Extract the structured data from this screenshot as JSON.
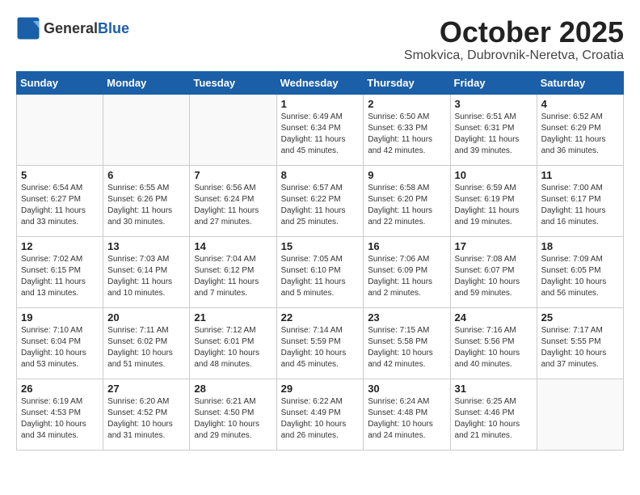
{
  "header": {
    "logo_general": "General",
    "logo_blue": "Blue",
    "month": "October 2025",
    "location": "Smokvica, Dubrovnik-Neretva, Croatia"
  },
  "weekdays": [
    "Sunday",
    "Monday",
    "Tuesday",
    "Wednesday",
    "Thursday",
    "Friday",
    "Saturday"
  ],
  "weeks": [
    [
      {
        "day": "",
        "info": ""
      },
      {
        "day": "",
        "info": ""
      },
      {
        "day": "",
        "info": ""
      },
      {
        "day": "1",
        "info": "Sunrise: 6:49 AM\nSunset: 6:34 PM\nDaylight: 11 hours\nand 45 minutes."
      },
      {
        "day": "2",
        "info": "Sunrise: 6:50 AM\nSunset: 6:33 PM\nDaylight: 11 hours\nand 42 minutes."
      },
      {
        "day": "3",
        "info": "Sunrise: 6:51 AM\nSunset: 6:31 PM\nDaylight: 11 hours\nand 39 minutes."
      },
      {
        "day": "4",
        "info": "Sunrise: 6:52 AM\nSunset: 6:29 PM\nDaylight: 11 hours\nand 36 minutes."
      }
    ],
    [
      {
        "day": "5",
        "info": "Sunrise: 6:54 AM\nSunset: 6:27 PM\nDaylight: 11 hours\nand 33 minutes."
      },
      {
        "day": "6",
        "info": "Sunrise: 6:55 AM\nSunset: 6:26 PM\nDaylight: 11 hours\nand 30 minutes."
      },
      {
        "day": "7",
        "info": "Sunrise: 6:56 AM\nSunset: 6:24 PM\nDaylight: 11 hours\nand 27 minutes."
      },
      {
        "day": "8",
        "info": "Sunrise: 6:57 AM\nSunset: 6:22 PM\nDaylight: 11 hours\nand 25 minutes."
      },
      {
        "day": "9",
        "info": "Sunrise: 6:58 AM\nSunset: 6:20 PM\nDaylight: 11 hours\nand 22 minutes."
      },
      {
        "day": "10",
        "info": "Sunrise: 6:59 AM\nSunset: 6:19 PM\nDaylight: 11 hours\nand 19 minutes."
      },
      {
        "day": "11",
        "info": "Sunrise: 7:00 AM\nSunset: 6:17 PM\nDaylight: 11 hours\nand 16 minutes."
      }
    ],
    [
      {
        "day": "12",
        "info": "Sunrise: 7:02 AM\nSunset: 6:15 PM\nDaylight: 11 hours\nand 13 minutes."
      },
      {
        "day": "13",
        "info": "Sunrise: 7:03 AM\nSunset: 6:14 PM\nDaylight: 11 hours\nand 10 minutes."
      },
      {
        "day": "14",
        "info": "Sunrise: 7:04 AM\nSunset: 6:12 PM\nDaylight: 11 hours\nand 7 minutes."
      },
      {
        "day": "15",
        "info": "Sunrise: 7:05 AM\nSunset: 6:10 PM\nDaylight: 11 hours\nand 5 minutes."
      },
      {
        "day": "16",
        "info": "Sunrise: 7:06 AM\nSunset: 6:09 PM\nDaylight: 11 hours\nand 2 minutes."
      },
      {
        "day": "17",
        "info": "Sunrise: 7:08 AM\nSunset: 6:07 PM\nDaylight: 10 hours\nand 59 minutes."
      },
      {
        "day": "18",
        "info": "Sunrise: 7:09 AM\nSunset: 6:05 PM\nDaylight: 10 hours\nand 56 minutes."
      }
    ],
    [
      {
        "day": "19",
        "info": "Sunrise: 7:10 AM\nSunset: 6:04 PM\nDaylight: 10 hours\nand 53 minutes."
      },
      {
        "day": "20",
        "info": "Sunrise: 7:11 AM\nSunset: 6:02 PM\nDaylight: 10 hours\nand 51 minutes."
      },
      {
        "day": "21",
        "info": "Sunrise: 7:12 AM\nSunset: 6:01 PM\nDaylight: 10 hours\nand 48 minutes."
      },
      {
        "day": "22",
        "info": "Sunrise: 7:14 AM\nSunset: 5:59 PM\nDaylight: 10 hours\nand 45 minutes."
      },
      {
        "day": "23",
        "info": "Sunrise: 7:15 AM\nSunset: 5:58 PM\nDaylight: 10 hours\nand 42 minutes."
      },
      {
        "day": "24",
        "info": "Sunrise: 7:16 AM\nSunset: 5:56 PM\nDaylight: 10 hours\nand 40 minutes."
      },
      {
        "day": "25",
        "info": "Sunrise: 7:17 AM\nSunset: 5:55 PM\nDaylight: 10 hours\nand 37 minutes."
      }
    ],
    [
      {
        "day": "26",
        "info": "Sunrise: 6:19 AM\nSunset: 4:53 PM\nDaylight: 10 hours\nand 34 minutes."
      },
      {
        "day": "27",
        "info": "Sunrise: 6:20 AM\nSunset: 4:52 PM\nDaylight: 10 hours\nand 31 minutes."
      },
      {
        "day": "28",
        "info": "Sunrise: 6:21 AM\nSunset: 4:50 PM\nDaylight: 10 hours\nand 29 minutes."
      },
      {
        "day": "29",
        "info": "Sunrise: 6:22 AM\nSunset: 4:49 PM\nDaylight: 10 hours\nand 26 minutes."
      },
      {
        "day": "30",
        "info": "Sunrise: 6:24 AM\nSunset: 4:48 PM\nDaylight: 10 hours\nand 24 minutes."
      },
      {
        "day": "31",
        "info": "Sunrise: 6:25 AM\nSunset: 4:46 PM\nDaylight: 10 hours\nand 21 minutes."
      },
      {
        "day": "",
        "info": ""
      }
    ]
  ]
}
